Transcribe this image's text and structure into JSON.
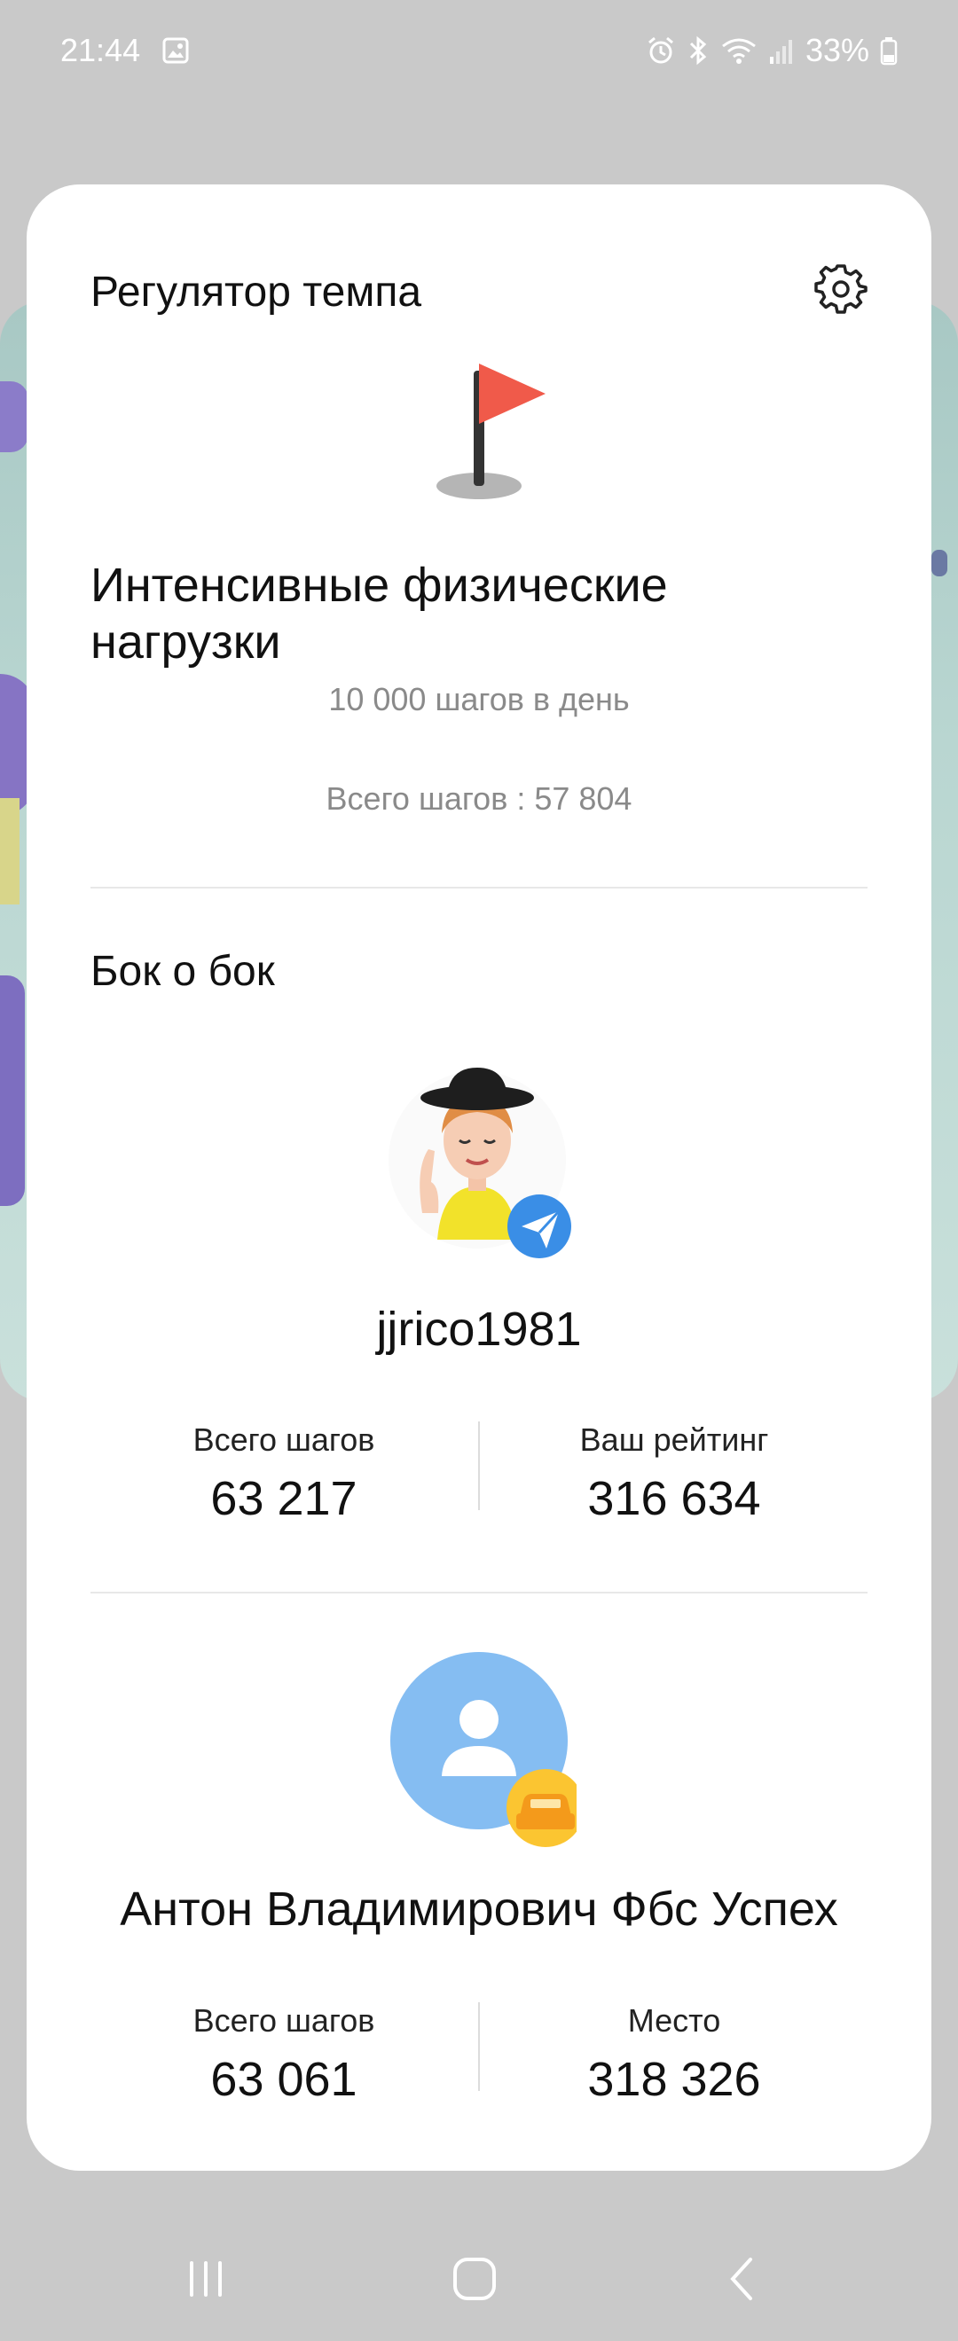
{
  "status_bar": {
    "time": "21:44",
    "battery": "33%",
    "icons": [
      "gallery-icon",
      "alarm-icon",
      "bluetooth-icon",
      "wifi-icon",
      "signal-icon",
      "battery-icon"
    ]
  },
  "card": {
    "title": "Регулятор темпа",
    "settings_icon": "gear-icon",
    "goal_icon": "flag-icon",
    "goal_title": "Интенсивные физические нагрузки",
    "goal_subtitle": "10 000 шагов в день",
    "goal_total": "Всего шагов : 57 804",
    "section_title": "Бок о бок",
    "competitor1": {
      "name": "jjrico1981",
      "stat_left_label": "Всего шагов",
      "stat_left_value": "63 217",
      "stat_right_label": "Ваш рейтинг",
      "stat_right_value": "316 634",
      "badge_icon": "send-badge-icon"
    },
    "competitor2": {
      "name": "Антон Владимирович Фбс Успех",
      "stat_left_label": "Всего шагов",
      "stat_left_value": "63 061",
      "stat_right_label": "Место",
      "stat_right_value": "318 326",
      "badge_icon": "car-badge-icon"
    }
  },
  "nav_bar": {
    "buttons": [
      "recent-apps-icon",
      "home-icon",
      "back-icon"
    ]
  },
  "colors": {
    "flag_red": "#f05a4a",
    "avatar_blue": "#7db9f0",
    "badge_orange": "#f8b830",
    "send_blue": "#2d86e0"
  }
}
